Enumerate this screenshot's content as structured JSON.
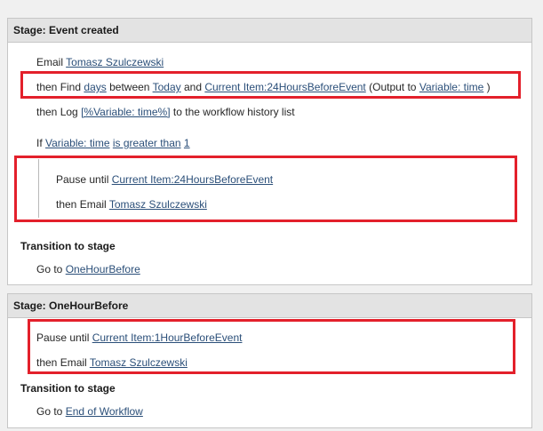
{
  "stage1": {
    "title": "Stage: Event created",
    "line1": {
      "prefix": "Email",
      "user": "Tomasz Szulczewski"
    },
    "line2": {
      "then_find": "then Find",
      "days": "days",
      "between": "between",
      "today": "Today",
      "and": "and",
      "field": "Current Item:24HoursBeforeEvent",
      "output_prefix": "(Output to",
      "variable": "Variable: time",
      "output_suffix": ")"
    },
    "line3": {
      "prefix": "then Log",
      "log_value": "[%Variable: time%]",
      "suffix": "to the workflow history list"
    },
    "line4": {
      "prefix": "If",
      "variable": "Variable: time",
      "operator": "is greater than",
      "value": "1"
    },
    "line5": {
      "prefix": "Pause until",
      "field": "Current Item:24HoursBeforeEvent"
    },
    "line6": {
      "prefix": "then Email",
      "user": "Tomasz Szulczewski"
    },
    "transition_heading": "Transition to stage",
    "goto_prefix": "Go to",
    "goto_target": "OneHourBefore"
  },
  "stage2": {
    "title": "Stage: OneHourBefore",
    "line1": {
      "prefix": "Pause until",
      "field": "Current Item:1HourBeforeEvent"
    },
    "line2": {
      "prefix": "then Email",
      "user": "Tomasz Szulczewski"
    },
    "transition_heading": "Transition to stage",
    "goto_prefix": "Go to",
    "goto_target": "End of Workflow"
  },
  "colors": {
    "highlight_border": "#e3202b",
    "link": "#2b4f79",
    "header_bg": "#e3e3e3"
  }
}
